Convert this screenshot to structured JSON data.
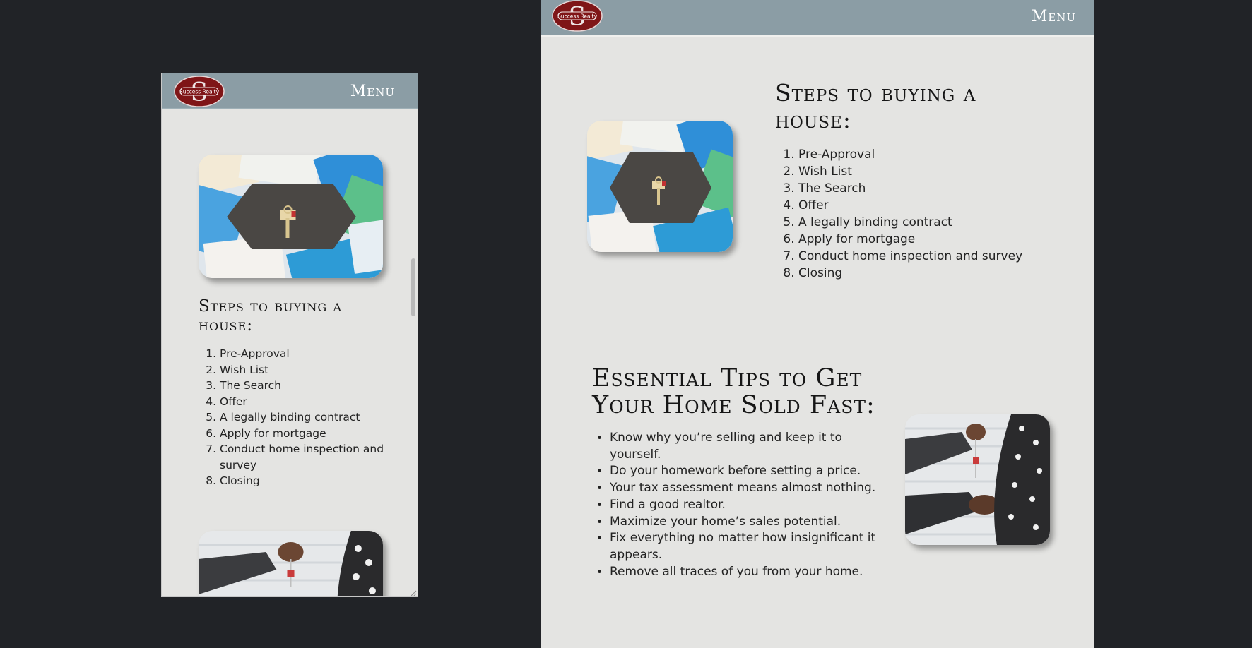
{
  "brand": {
    "logo_text": "Success Realty",
    "logo_letter": "S"
  },
  "nav": {
    "menu_label": "Menu"
  },
  "colors": {
    "navbar": "#8b9da5",
    "content_bg": "#e4e4e2",
    "page_bg": "#212327",
    "logo_red": "#7f1517"
  },
  "steps_section": {
    "heading": "Steps to buying a house:",
    "image_icon": "house-keys-on-real-estate-flyers-photo",
    "items": [
      "Pre-Approval",
      "Wish List",
      "The Search",
      "Offer",
      "A legally binding contract",
      "Apply for mortgage",
      "Conduct home inspection and survey",
      "Closing"
    ]
  },
  "tips_section": {
    "heading": "Essential Tips to Get Your Home Sold Fast:",
    "image_icon": "handshake-with-house-key-photo",
    "items": [
      "Know why you’re selling and keep it to yourself.",
      "Do your homework before setting a price.",
      "Your tax assessment means almost nothing.",
      "Find a good realtor.",
      "Maximize your home’s sales potential.",
      "Fix everything no matter how insignificant it appears.",
      "Remove all traces of you from your home."
    ]
  }
}
